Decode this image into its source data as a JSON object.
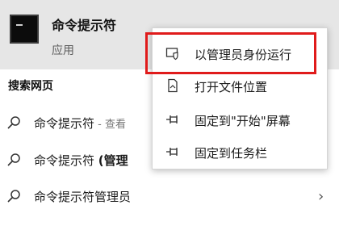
{
  "best_match": {
    "title": "命令提示符",
    "subtitle": "应用",
    "icon": "command-prompt-icon"
  },
  "web_section": {
    "heading": "搜索网页",
    "results": [
      {
        "main": "命令提示符",
        "suffix": " - 查看",
        "icon": "search-icon"
      },
      {
        "main": "命令提示符 ",
        "suffix": "(管理",
        "icon": "search-icon"
      },
      {
        "main": "命令提示符管理员",
        "suffix": "",
        "icon": "search-icon"
      }
    ]
  },
  "context_menu": {
    "items": [
      {
        "label": "以管理员身份运行",
        "icon": "shield-run-icon"
      },
      {
        "label": "打开文件位置",
        "icon": "file-location-icon"
      },
      {
        "label": "固定到\"开始\"屏幕",
        "icon": "pin-icon"
      },
      {
        "label": "固定到任务栏",
        "icon": "pin-icon"
      }
    ]
  },
  "colors": {
    "header_bg": "#e6e6e6",
    "highlight_border": "#e01b1b"
  }
}
